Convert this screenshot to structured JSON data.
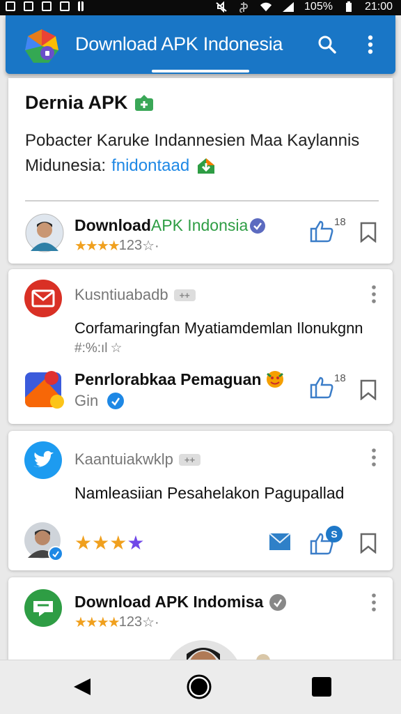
{
  "status_bar": {
    "battery": "105%",
    "time": "21:00"
  },
  "app_bar": {
    "title": "Download APK Indonesia",
    "icons": [
      "search-icon",
      "more-vert-icon"
    ]
  },
  "featured": {
    "heading": "Dernia APK",
    "body_line1": "Pobacter Karuke Indannesien Maa Kaylannis",
    "body_line2": "Midunesia:",
    "link": "fnidontaad",
    "app_name_part1": "Download ",
    "app_name_part2": "APK Indonsia",
    "rating_count": "123",
    "like_count": "18"
  },
  "feed": [
    {
      "source": "Kusntiuabadb",
      "headline": "Corfamaringfan Myatiamdemlan Ilonukgnn",
      "meta": "#:%:ıl",
      "app_title": "Penrlorabkaa Pemaguan",
      "app_sub": "Gin",
      "like_count": "18"
    },
    {
      "source": "Kaantuiakwklp",
      "headline": "Namleasiian Pesahelakon Pagupallad",
      "like_badge": "S"
    },
    {
      "title": "Download APK Indomisa",
      "rating_count": "123"
    }
  ],
  "badge_text": "++"
}
